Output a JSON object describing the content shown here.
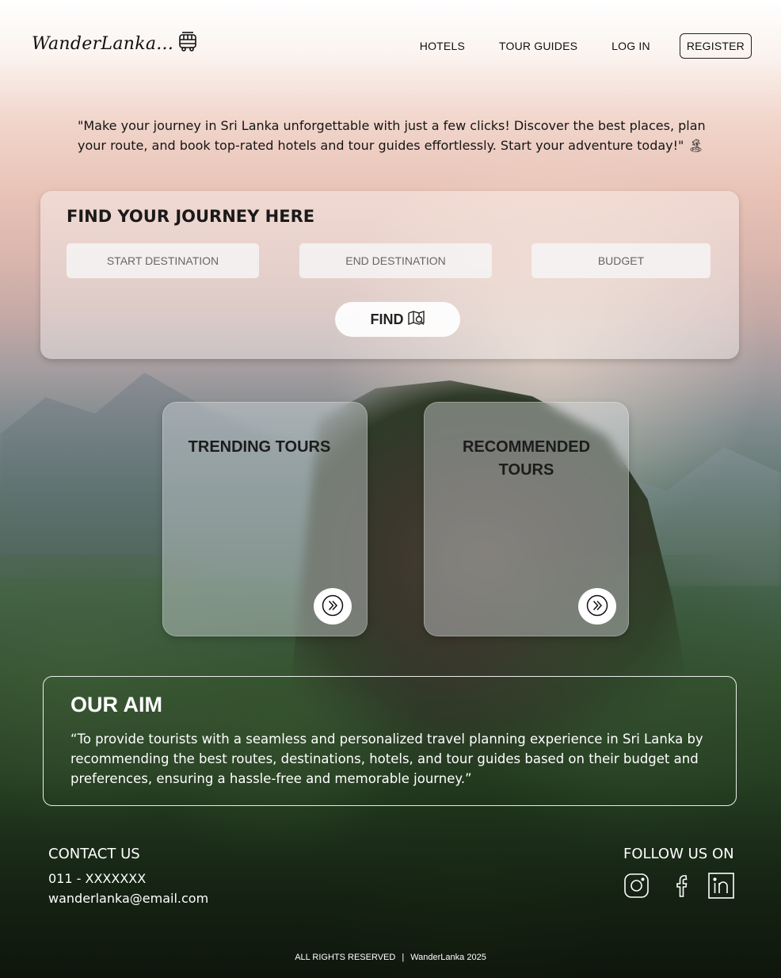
{
  "header": {
    "logo_text": "WanderLanka...",
    "logo_icon": "bus-icon",
    "nav": {
      "hotels": "HOTELS",
      "tour_guides": "TOUR GUIDES",
      "login": "LOG IN",
      "register": "REGISTER"
    }
  },
  "tagline": "\"Make your journey in Sri Lanka unforgettable with just a few clicks! Discover the best places, plan your route, and book top-rated hotels and tour guides effortlessly. Start your adventure today!\" 🏝",
  "search": {
    "title": "FIND YOUR JOURNEY HERE",
    "start_placeholder": "START DESTINATION",
    "end_placeholder": "END DESTINATION",
    "budget_placeholder": "BUDGET",
    "find_label": "FIND",
    "find_icon": "map-search-icon"
  },
  "tours": {
    "trending": {
      "title": "TRENDING TOURS",
      "button_icon": "double-chevron-right-icon"
    },
    "recommended": {
      "title": "RECOMMENDED TOURS",
      "button_icon": "double-chevron-right-icon"
    }
  },
  "aim": {
    "title": "OUR AIM",
    "text": "“To provide tourists with a seamless and personalized travel planning experience in Sri Lanka by recommending the best routes, destinations, hotels, and tour guides based on their budget and preferences, ensuring a hassle-free and memorable journey.”"
  },
  "footer": {
    "contact_title": "CONTACT US",
    "phone": "011 - XXXXXXX",
    "email": "wanderlanka@email.com",
    "follow_title": "FOLLOW US ON",
    "social_icons": [
      "instagram-icon",
      "facebook-icon",
      "linkedin-icon"
    ],
    "rights": "ALL RIGHTS RESERVED",
    "brand_year": "WanderLanka 2025"
  },
  "colors": {
    "text_dark": "#111111",
    "text_light": "#ffffff",
    "panel_bg": "rgba(255,255,255,0.38)"
  }
}
